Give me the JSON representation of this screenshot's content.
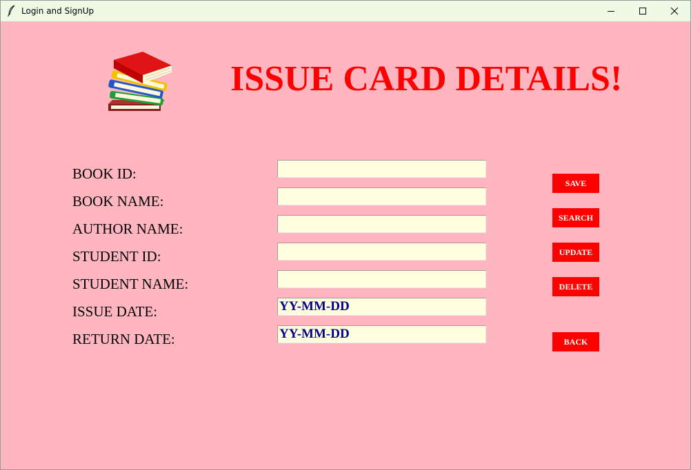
{
  "window": {
    "title": "Login and SignUp",
    "controls": {
      "minimize_icon": "minimize-icon",
      "maximize_icon": "maximize-icon",
      "close_icon": "close-icon"
    }
  },
  "header": {
    "logo_icon": "books-stack-icon",
    "title": "ISSUE CARD DETAILS!"
  },
  "form": {
    "fields": [
      {
        "label": "BOOK ID:",
        "value": ""
      },
      {
        "label": "BOOK NAME:",
        "value": ""
      },
      {
        "label": "AUTHOR NAME:",
        "value": ""
      },
      {
        "label": "STUDENT ID:",
        "value": ""
      },
      {
        "label": "STUDENT NAME:",
        "value": ""
      },
      {
        "label": "ISSUE DATE:",
        "value": "YY-MM-DD"
      },
      {
        "label": "RETURN DATE:",
        "value": "YY-MM-DD"
      }
    ]
  },
  "buttons": {
    "save": "SAVE",
    "search": "SEARCH",
    "update": "UPDATE",
    "delete": "DELETE",
    "back": "BACK"
  },
  "colors": {
    "background": "#ffb6c1",
    "title": "#ff0000",
    "button": "#ff0000",
    "button_text": "#ffffff",
    "field_bg": "#ffffe0",
    "field_text": "#00008b",
    "titlebar": "#eef9e6"
  }
}
